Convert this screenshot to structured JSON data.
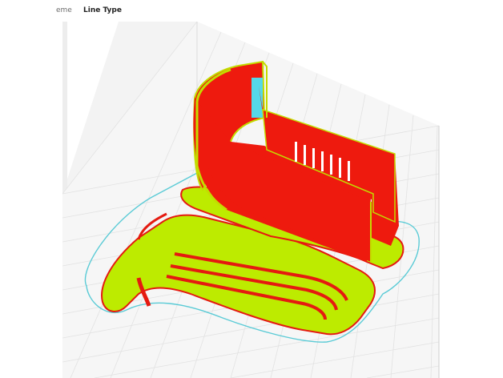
{
  "toolbar": {
    "color_scheme_label": "eme",
    "color_scheme_value": "Line Type"
  },
  "colors": {
    "background": "#ffffff",
    "grid_floor": "#f4f4f4",
    "grid_line": "#e0e0e0",
    "back_wall": "#f2f2f2",
    "wall_edge": "#cccccc",
    "outer_wall": "#ef1a0f",
    "inner_wall": "#bdeb00",
    "support_cyan": "#52d8e6",
    "skirt": "#58c9d4"
  },
  "viewport": {
    "mode": "layer-view",
    "objects": [
      "phone-holder-clip",
      "cable-organizer-box"
    ]
  }
}
